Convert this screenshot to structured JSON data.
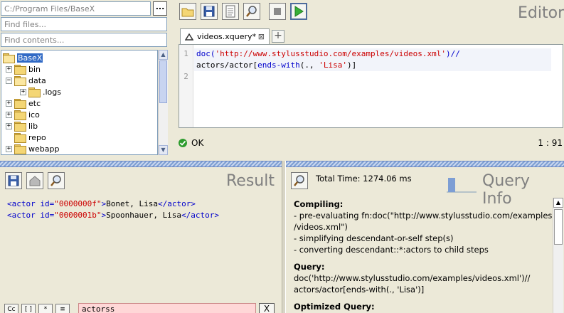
{
  "explorer": {
    "path": "C:/Program Files/BaseX",
    "browse_label": "...",
    "find_files_placeholder": "Find files...",
    "find_contents_placeholder": "Find contents...",
    "tree": [
      {
        "label": "BaseX",
        "selected": true,
        "open": true,
        "expander": ""
      },
      {
        "label": "bin",
        "expander": "+"
      },
      {
        "label": "data",
        "open": true,
        "expander": "−"
      },
      {
        "label": ".logs",
        "expander": "+"
      },
      {
        "label": "etc",
        "expander": "+"
      },
      {
        "label": "ico",
        "expander": "+"
      },
      {
        "label": "lib",
        "expander": "+"
      },
      {
        "label": "repo",
        "expander": ""
      },
      {
        "label": "webapp",
        "expander": "+"
      }
    ]
  },
  "editor": {
    "title": "Editor",
    "tab_label": "videos.xquery*",
    "tab_close": "⊠",
    "tab_add": "+",
    "line_numbers": [
      "1",
      "",
      "2"
    ],
    "code": {
      "l1_fn": "doc(",
      "l1_str": "'http://www.stylusstudio.com/examples/videos.xml'",
      "l1_end": ")//",
      "l2_path": "actors/actor[",
      "l2_fn": "ends-with",
      "l2_args": "(., ",
      "l2_str": "'Lisa'",
      "l2_end": ")]"
    },
    "status": "OK",
    "position": "1 : 91"
  },
  "result": {
    "title": "Result",
    "lines": [
      {
        "open": "<actor ",
        "attr": "id=",
        "val": "\"0000000f\"",
        "close": ">",
        "text": "Bonet, Lisa",
        "end": "</actor>"
      },
      {
        "open": "<actor ",
        "attr": "id=",
        "val": "\"0000001b\"",
        "close": ">",
        "text": "Spoonhauer, Lisa",
        "end": "</actor>"
      }
    ],
    "search_buttons": [
      "Cc",
      "[ ]",
      "*",
      "≡"
    ],
    "search_value": "actorss",
    "close_label": "X"
  },
  "query_info": {
    "title": "Query Info",
    "total_time": "Total Time: 1274.06 ms",
    "compiling_heading": "Compiling:",
    "compiling_lines": [
      "- pre-evaluating fn:doc(\"http://www.stylusstudio.com/examples",
      "/videos.xml\")",
      "- simplifying descendant-or-self step(s)",
      "- converting descendant::*:actors to child steps"
    ],
    "query_heading": "Query:",
    "query_lines": [
      "doc('http://www.stylusstudio.com/examples/videos.xml')//",
      "actors/actor[ends-with(., 'Lisa')]"
    ],
    "optimized_heading": "Optimized Query:"
  },
  "colors": {
    "accent": "#316ac5",
    "splitter": "#7e9fd3",
    "ok_green": "#2e9c2e",
    "search_bg": "#ffd7d7"
  }
}
